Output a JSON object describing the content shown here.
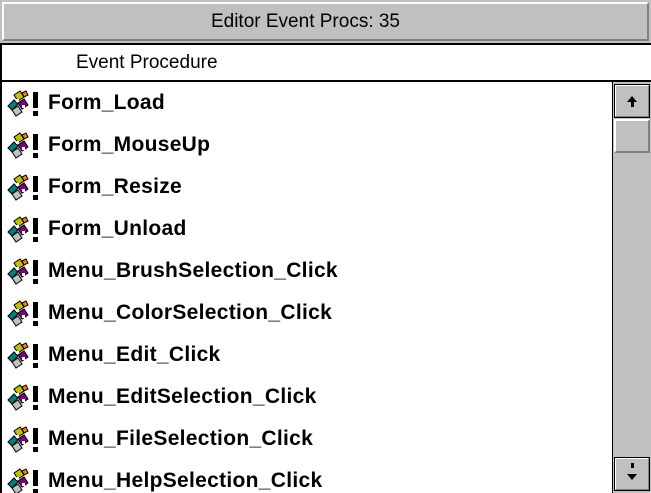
{
  "window": {
    "title": "Editor Event Procs: 35"
  },
  "list": {
    "column_header": "Event Procedure",
    "row_icon": "event-procedure-icon",
    "rows": [
      {
        "label": "Form_Load"
      },
      {
        "label": "Form_MouseUp"
      },
      {
        "label": "Form_Resize"
      },
      {
        "label": "Form_Unload"
      },
      {
        "label": "Menu_BrushSelection_Click"
      },
      {
        "label": "Menu_ColorSelection_Click"
      },
      {
        "label": "Menu_Edit_Click"
      },
      {
        "label": "Menu_EditSelection_Click"
      },
      {
        "label": "Menu_FileSelection_Click"
      },
      {
        "label": "Menu_HelpSelection_Click"
      }
    ]
  },
  "scrollbar": {
    "up_icon": "arrow-up-icon",
    "down_icon": "arrow-down-icon",
    "position": 0.0
  },
  "colors": {
    "window_bg": "#c0c0c0",
    "list_bg": "#ffffff",
    "text": "#000000"
  }
}
